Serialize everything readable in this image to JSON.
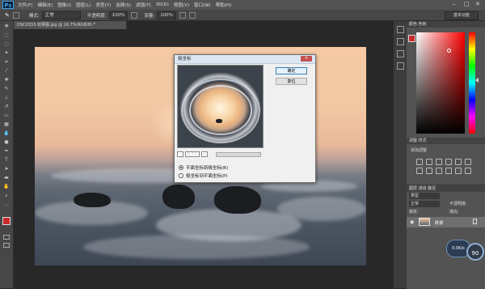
{
  "app": {
    "logo": "Ps",
    "win_min": "–",
    "win_max": "□",
    "win_close": "✕"
  },
  "menu": [
    "文件(F)",
    "编辑(E)",
    "图像(I)",
    "图层(L)",
    "类型(Y)",
    "选择(S)",
    "滤镜(T)",
    "3D(D)",
    "视图(V)",
    "窗口(W)",
    "帮助(H)"
  ],
  "options": {
    "mode_label": "模式:",
    "mode_value": "正常",
    "opacity_label": "不透明度:",
    "opacity_value": "100%",
    "flow_label": "流量:",
    "flow_value": "100%",
    "workspace": "基本功能"
  },
  "document": {
    "tab": "DSC0333-效果图.jpg @ 16.7%(RGB/8) *"
  },
  "dialog": {
    "title": "极坐标",
    "ok": "确定",
    "reset": "复位",
    "zoom_minus": "−",
    "zoom_plus": "+",
    "zoom_value": "6.3%",
    "option_1": "平面坐标到极坐标(R)",
    "option_2": "极坐标到平面坐标(P)",
    "selected": 1
  },
  "panels": {
    "color_tabs": "颜色  色板",
    "adjust_tabs": "调整  样式",
    "adjust_label": "添加调整",
    "layers_tabs": "图层  通道  路径",
    "kind_label": "类型",
    "blend_mode": "正常",
    "opacity_label": "不透明度:",
    "lock_label": "锁定:",
    "fill_label": "填充:",
    "layer_name": "背景"
  },
  "widget": {
    "speed": "0.0K/s",
    "percent": "90"
  },
  "colors": {
    "foreground": "#c92b2b",
    "background": "#ffffff",
    "accent": "#31a8ff"
  }
}
